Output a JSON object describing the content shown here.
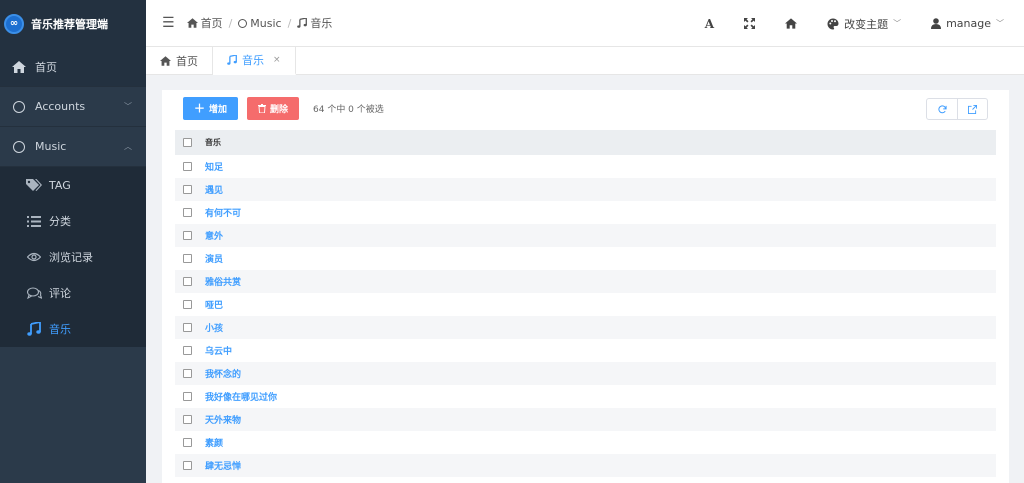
{
  "app": {
    "title": "音乐推荐管理端"
  },
  "sidebar": {
    "home": {
      "label": "首页",
      "icon": "home-icon"
    },
    "accounts": {
      "label": "Accounts",
      "icon": "circle-icon"
    },
    "music": {
      "label": "Music",
      "icon": "circle-icon"
    },
    "items": [
      {
        "label": "TAG",
        "icon": "tags-icon"
      },
      {
        "label": "分类",
        "icon": "list-icon"
      },
      {
        "label": "浏览记录",
        "icon": "eye-icon"
      },
      {
        "label": "评论",
        "icon": "comments-icon"
      },
      {
        "label": "音乐",
        "icon": "music-icon"
      }
    ]
  },
  "header": {
    "breadcrumb": [
      "首页",
      "Music",
      "音乐"
    ],
    "theme_label": "改变主题",
    "user_label": "manage",
    "font_label": "A"
  },
  "tabs": [
    {
      "label": "首页"
    },
    {
      "label": "音乐",
      "close": "×"
    }
  ],
  "toolbar": {
    "add_label": "增加",
    "delete_label": "删除",
    "selection_text": "64 个中 0 个被选"
  },
  "table": {
    "header": "音乐",
    "rows": [
      "知足",
      "遇见",
      "有何不可",
      "意外",
      "演员",
      "雅俗共赏",
      "哑巴",
      "小孩",
      "乌云中",
      "我怀念的",
      "我好像在哪见过你",
      "天外来物",
      "素颜",
      "肆无忌惮"
    ]
  },
  "colors": {
    "accent": "#409eff",
    "danger": "#f56c6c",
    "sidebar": "#2b3a4a"
  }
}
